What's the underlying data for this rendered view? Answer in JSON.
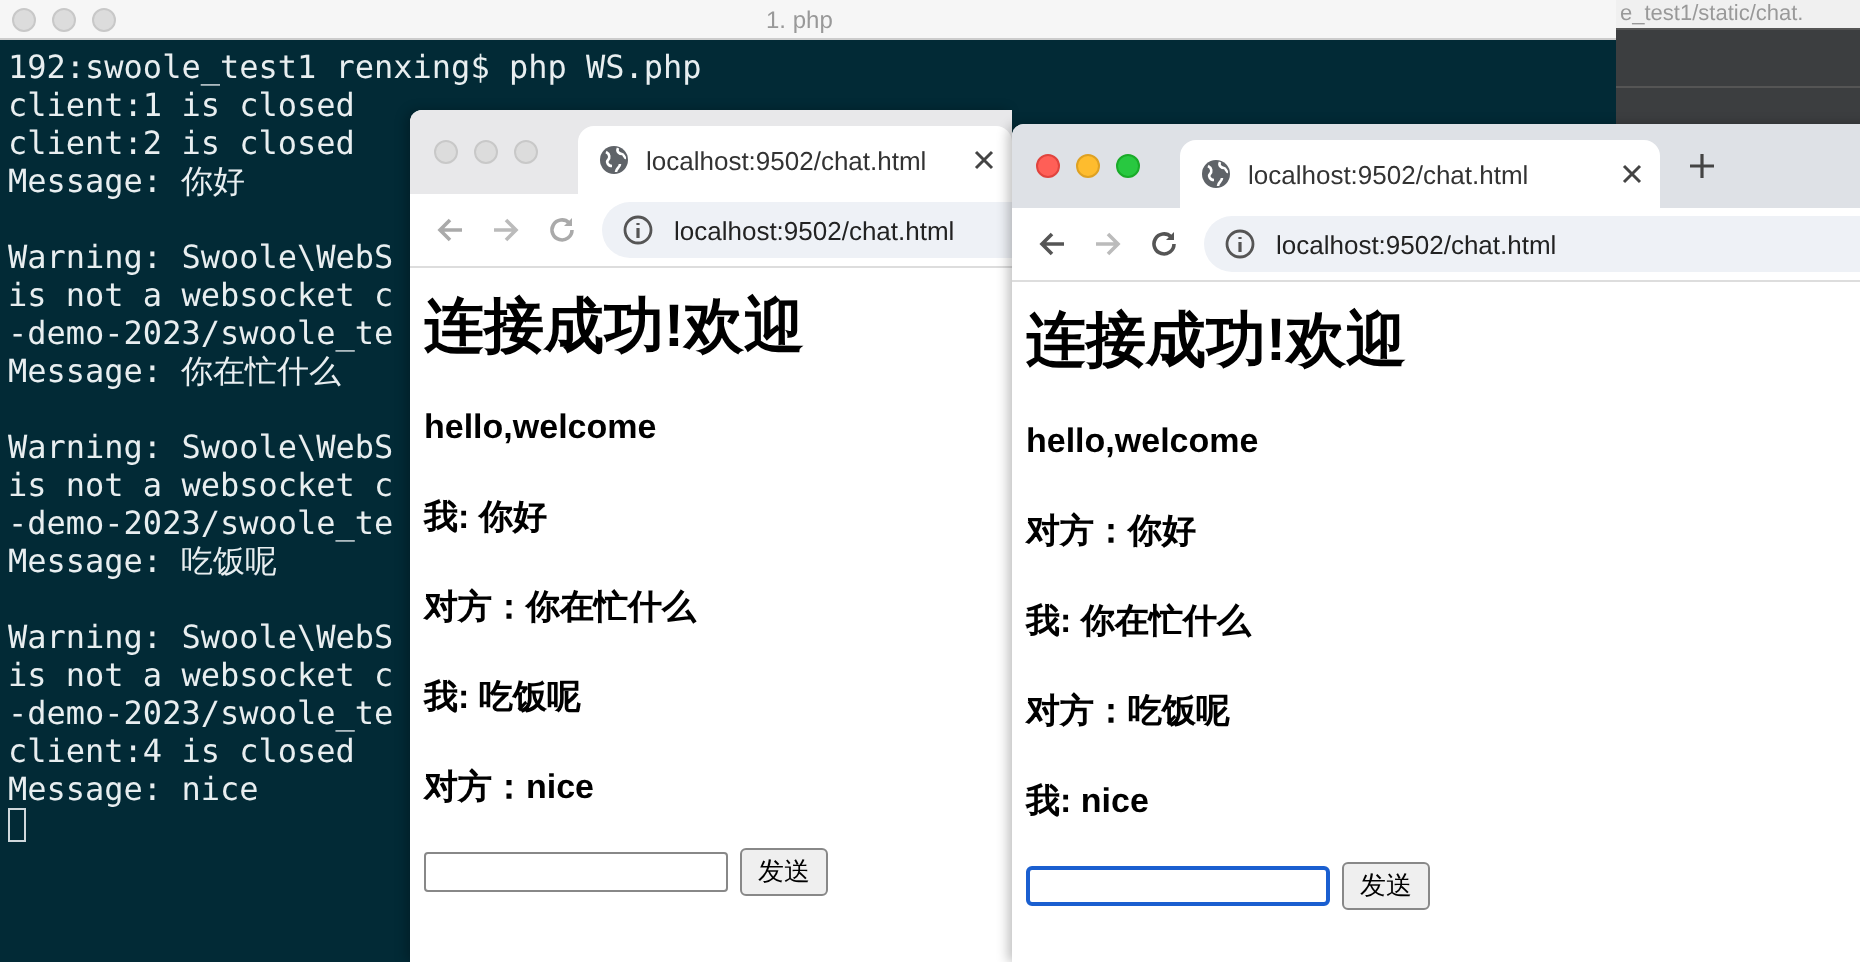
{
  "background_window": {
    "title": "e_test1/static/chat."
  },
  "terminal": {
    "title": "1. php",
    "cursor": true,
    "blocks": [
      [
        "192:swoole_test1 renxing$ php WS.php",
        "client:1 is closed",
        "client:2 is closed",
        "Message: 你好"
      ],
      [
        "Warning: Swoole\\WebS",
        "is not a websocket c",
        "-demo-2023/swoole_te",
        "Message: 你在忙什么"
      ],
      [
        "Warning: Swoole\\WebS",
        "is not a websocket c",
        "-demo-2023/swoole_te",
        "Message: 吃饭呢"
      ],
      [
        "Warning: Swoole\\WebS",
        "is not a websocket c",
        "-demo-2023/swoole_te",
        "client:4 is closed",
        "Message: nice"
      ]
    ]
  },
  "browsers": [
    {
      "active": false,
      "show_new_tab": false,
      "tab": "localhost:9502/chat.html",
      "address": "localhost:9502/chat.html",
      "heading": "连接成功!欢迎",
      "messages": [
        "hello,welcome",
        "我: 你好",
        "对方：你在忙什么",
        "我: 吃饭呢",
        "对方：nice"
      ],
      "input": {
        "focused": false
      },
      "send_button": "发送"
    },
    {
      "active": true,
      "show_new_tab": true,
      "tab": "localhost:9502/chat.html",
      "address": "localhost:9502/chat.html",
      "heading": "连接成功!欢迎",
      "messages": [
        "hello,welcome",
        "对方：你好",
        "我: 你在忙什么",
        "对方：吃饭呢",
        "我: nice"
      ],
      "input": {
        "focused": true
      },
      "send_button": "发送"
    }
  ]
}
